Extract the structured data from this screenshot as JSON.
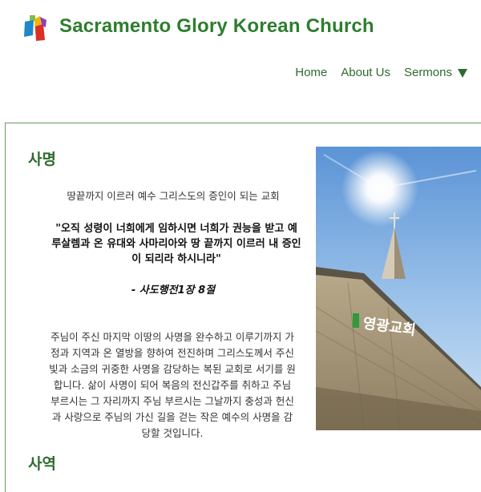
{
  "header": {
    "title": "Sacramento Glory Korean Church",
    "logo_icon": "church-logo-icon",
    "colors": {
      "brand_green": "#2e7d2e"
    }
  },
  "nav": {
    "items": [
      {
        "label": "Home"
      },
      {
        "label": "About Us"
      },
      {
        "label": "Sermons",
        "icon": "triangle-down-icon"
      }
    ]
  },
  "mission": {
    "heading": "사명",
    "subtitle": "땅끝까지 이르러 예수 그리스도의 증인이 되는 교회",
    "quote_lines": [
      "\"오직 성령이 너희에게 임하시면 너희가 권능을 받고 예",
      "루살렘과 온 유대와 사마리아와 땅 끝까지 이르러 내 증인",
      "이 되리라 하시니라\""
    ],
    "quote_ref": "- 사도행전1장 8절",
    "body_lines": [
      "주님이 주신 마지막 이땅의 사명을 완수하고 이루기까지 가",
      "정과 지역과 온 열방을 향하여 전진하며 그리스도께서 주신",
      "빛과 소금의 귀중한 사명을 감당하는 복된 교회로 서기를 원",
      "합니다. 삶이 사명이 되어 복음의 전신갑주를 취하고 주님",
      "부르시는 그 자리까지 주님 부르시는 그날까지 충성과 헌신",
      "과 사랑으로 주님의 가신 길을 걷는 작은 예수의 사명을 감",
      "당할 것입니다."
    ]
  },
  "ministry": {
    "heading": "사역"
  },
  "photo": {
    "sign_text": "영광교회"
  }
}
